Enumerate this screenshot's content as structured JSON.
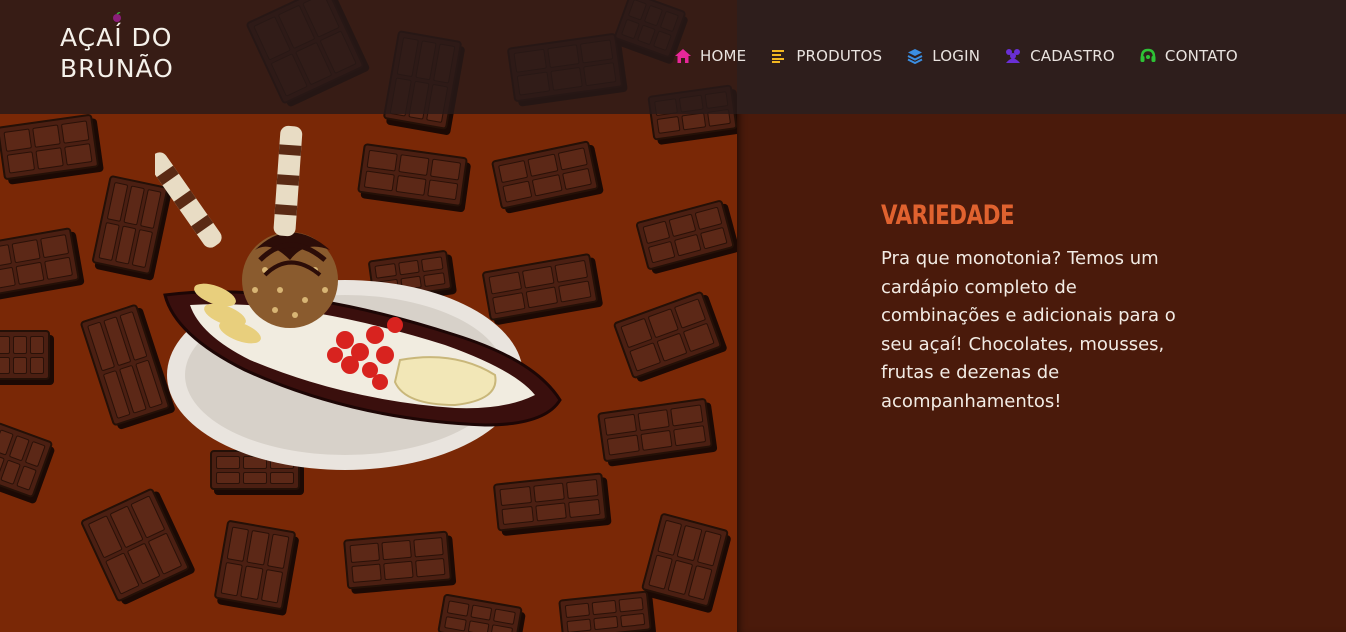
{
  "brand": {
    "line1": "AÇAÍ DO",
    "line2": "BRUNÃO"
  },
  "nav": [
    {
      "label": "HOME",
      "icon": "home-icon",
      "color": "#e8279a"
    },
    {
      "label": "PRODUTOS",
      "icon": "list-icon",
      "color": "#f2b821"
    },
    {
      "label": "LOGIN",
      "icon": "layers-icon",
      "color": "#3b8fe3"
    },
    {
      "label": "CADASTRO",
      "icon": "users-icon",
      "color": "#6a2fd6"
    },
    {
      "label": "CONTATO",
      "icon": "headset-icon",
      "color": "#2ec236"
    }
  ],
  "feature": {
    "title": "VARIEDADE",
    "description": "Pra que monotonia? Temos um cardápio completo de combinações e adicionais para o seu açaí! Chocolates, mousses, frutas e dezenas de acompanhamentos!"
  },
  "colors": {
    "accent": "#e0622f",
    "panel_left": "#7a2806",
    "panel_right": "#4a1a0b",
    "topbar": "#2e1e1c"
  }
}
